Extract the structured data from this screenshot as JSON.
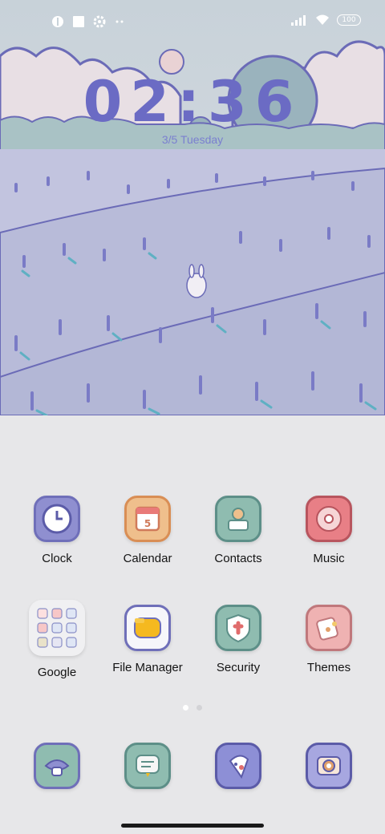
{
  "status_bar": {
    "battery": "100",
    "icons": [
      "badge-icon",
      "square-icon",
      "settings-icon",
      "more-dots-icon",
      "signal-icon",
      "wifi-icon",
      "battery-icon"
    ]
  },
  "lock_clock": {
    "time": "02:36",
    "date": "3/5  Tuesday",
    "color": "#6b6bc4"
  },
  "home_grid": {
    "row1": [
      {
        "label": "Clock",
        "icon": "clock-icon",
        "color": "#8f8fd0"
      },
      {
        "label": "Calendar",
        "icon": "calendar-icon",
        "color": "#efbf8c"
      },
      {
        "label": "Contacts",
        "icon": "contacts-icon",
        "color": "#8fbcb0"
      },
      {
        "label": "Music",
        "icon": "music-icon",
        "color": "#e87f86"
      }
    ],
    "row2": [
      {
        "label": "Google",
        "icon": "google-folder-icon",
        "color": "#f0f0f2"
      },
      {
        "label": "File Manager",
        "icon": "folder-icon",
        "color": "#f6f6fa"
      },
      {
        "label": "Security",
        "icon": "shield-icon",
        "color": "#8fbcb0"
      },
      {
        "label": "Themes",
        "icon": "themes-icon",
        "color": "#efb2b2"
      }
    ]
  },
  "dock": [
    {
      "icon": "phone-icon",
      "color": "#8fbcb0"
    },
    {
      "icon": "messages-icon",
      "color": "#8fbcb0"
    },
    {
      "icon": "browser-icon",
      "color": "#8d8fd6"
    },
    {
      "icon": "camera-icon",
      "color": "#a7a7e0"
    }
  ],
  "pager": {
    "pages": 2,
    "current": 1
  }
}
